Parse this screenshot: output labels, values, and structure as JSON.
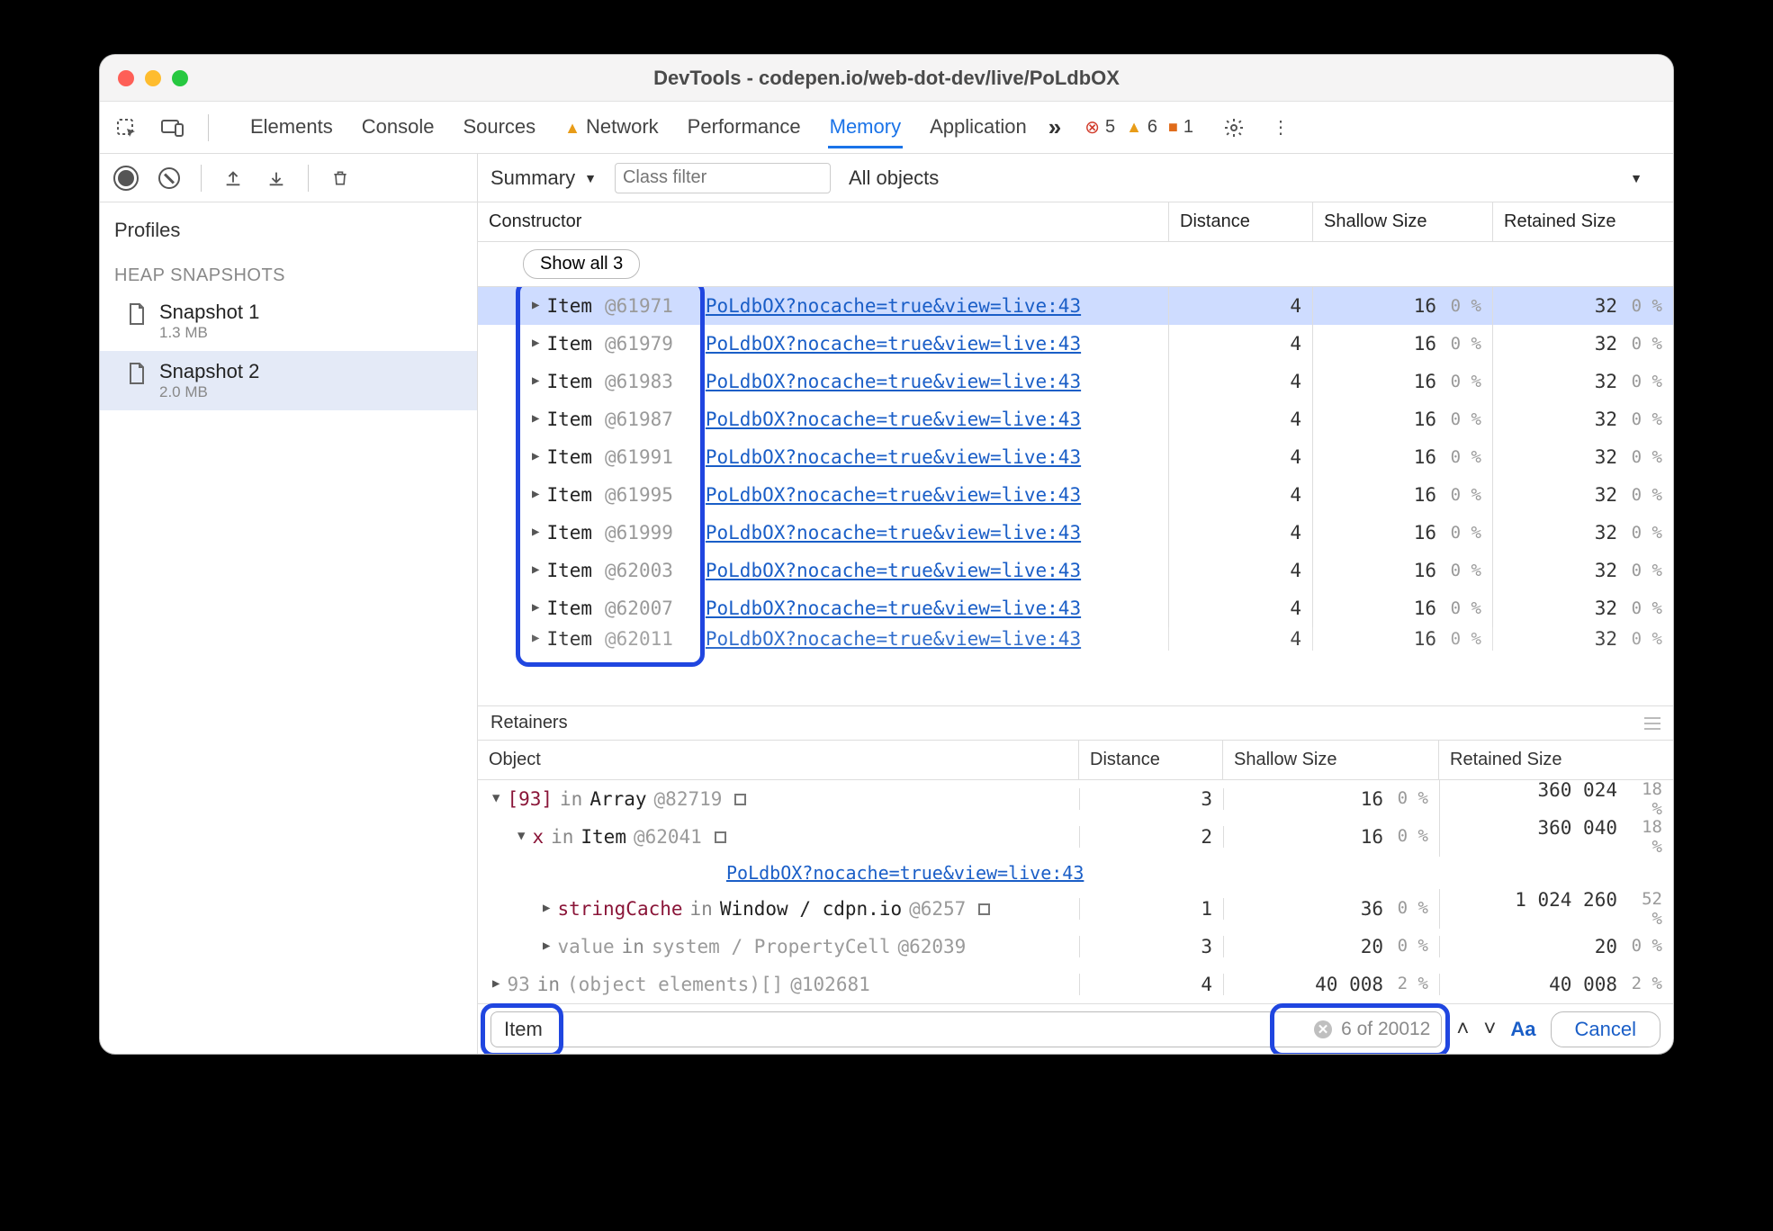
{
  "titlebar": {
    "title": "DevTools - codepen.io/web-dot-dev/live/PoLdbOX"
  },
  "tabs": {
    "items": [
      "Elements",
      "Console",
      "Sources",
      "Network",
      "Performance",
      "Memory",
      "Application"
    ],
    "active": "Memory",
    "warn_tab_index": 3
  },
  "counters": {
    "errors": "5",
    "warnings": "6",
    "issues": "1"
  },
  "filterbar": {
    "view": "Summary",
    "class_filter_placeholder": "Class filter",
    "scope": "All objects"
  },
  "profiles": {
    "title": "Profiles",
    "category": "HEAP SNAPSHOTS",
    "snapshots": [
      {
        "name": "Snapshot 1",
        "size": "1.3 MB",
        "selected": false
      },
      {
        "name": "Snapshot 2",
        "size": "2.0 MB",
        "selected": true
      }
    ]
  },
  "snapshot_headers": {
    "constructor": "Constructor",
    "distance": "Distance",
    "shallow": "Shallow Size",
    "retained": "Retained Size"
  },
  "show_all": "Show all 3",
  "snapshot_rows": [
    {
      "name": "Item",
      "id": "@61971",
      "link": "PoLdbOX?nocache=true&view=live:43",
      "distance": "4",
      "shallow": "16",
      "shallow_pct": "0 %",
      "retained": "32",
      "retained_pct": "0 %",
      "selected": true
    },
    {
      "name": "Item",
      "id": "@61979",
      "link": "PoLdbOX?nocache=true&view=live:43",
      "distance": "4",
      "shallow": "16",
      "shallow_pct": "0 %",
      "retained": "32",
      "retained_pct": "0 %"
    },
    {
      "name": "Item",
      "id": "@61983",
      "link": "PoLdbOX?nocache=true&view=live:43",
      "distance": "4",
      "shallow": "16",
      "shallow_pct": "0 %",
      "retained": "32",
      "retained_pct": "0 %"
    },
    {
      "name": "Item",
      "id": "@61987",
      "link": "PoLdbOX?nocache=true&view=live:43",
      "distance": "4",
      "shallow": "16",
      "shallow_pct": "0 %",
      "retained": "32",
      "retained_pct": "0 %"
    },
    {
      "name": "Item",
      "id": "@61991",
      "link": "PoLdbOX?nocache=true&view=live:43",
      "distance": "4",
      "shallow": "16",
      "shallow_pct": "0 %",
      "retained": "32",
      "retained_pct": "0 %"
    },
    {
      "name": "Item",
      "id": "@61995",
      "link": "PoLdbOX?nocache=true&view=live:43",
      "distance": "4",
      "shallow": "16",
      "shallow_pct": "0 %",
      "retained": "32",
      "retained_pct": "0 %"
    },
    {
      "name": "Item",
      "id": "@61999",
      "link": "PoLdbOX?nocache=true&view=live:43",
      "distance": "4",
      "shallow": "16",
      "shallow_pct": "0 %",
      "retained": "32",
      "retained_pct": "0 %"
    },
    {
      "name": "Item",
      "id": "@62003",
      "link": "PoLdbOX?nocache=true&view=live:43",
      "distance": "4",
      "shallow": "16",
      "shallow_pct": "0 %",
      "retained": "32",
      "retained_pct": "0 %"
    },
    {
      "name": "Item",
      "id": "@62007",
      "link": "PoLdbOX?nocache=true&view=live:43",
      "distance": "4",
      "shallow": "16",
      "shallow_pct": "0 %",
      "retained": "32",
      "retained_pct": "0 %"
    },
    {
      "name": "Item",
      "id": "@62011",
      "link": "PoLdbOX?nocache=true&view=live:43",
      "distance": "4",
      "shallow": "16",
      "shallow_pct": "0 %",
      "retained": "32",
      "retained_pct": "0 %",
      "peek": true
    }
  ],
  "retainers": {
    "label": "Retainers",
    "headers": {
      "object": "Object",
      "distance": "Distance",
      "shallow": "Shallow Size",
      "retained": "Retained Size"
    },
    "rows": [
      {
        "indent": 0,
        "arrow": "▼",
        "prop": "[93]",
        "kw": "in",
        "obj": "Array",
        "id": "@82719",
        "sq": true,
        "distance": "3",
        "shallow": "16",
        "shallow_pct": "0 %",
        "retained": "360 024",
        "retained_pct": "18 %"
      },
      {
        "indent": 1,
        "arrow": "▼",
        "prop": "x",
        "kw": "in",
        "obj": "Item",
        "id": "@62041",
        "sq": true,
        "distance": "2",
        "shallow": "16",
        "shallow_pct": "0 %",
        "retained": "360 040",
        "retained_pct": "18 %"
      },
      {
        "indent": 2,
        "link": "PoLdbOX?nocache=true&view=live:43"
      },
      {
        "indent": 2,
        "arrow": "▶",
        "prop": "stringCache",
        "kw": "in",
        "obj": "Window / cdpn.io",
        "id": "@6257",
        "sq": true,
        "distance": "1",
        "shallow": "36",
        "shallow_pct": "0 %",
        "retained": "1 024 260",
        "retained_pct": "52 %"
      },
      {
        "indent": 2,
        "arrow": "▶",
        "prop": "value",
        "kw": "in",
        "obj": "system / PropertyCell",
        "id": "@62039",
        "muted": true,
        "distance": "3",
        "shallow": "20",
        "shallow_pct": "0 %",
        "retained": "20",
        "retained_pct": "0 %"
      },
      {
        "indent": 0,
        "arrow": "▶",
        "prop": "93",
        "kw": "in",
        "obj": "(object elements)[]",
        "id": "@102681",
        "muted": true,
        "distance": "4",
        "shallow": "40 008",
        "shallow_pct": "2 %",
        "retained": "40 008",
        "retained_pct": "2 %"
      }
    ]
  },
  "search": {
    "value": "Item",
    "counter": "6 of 20012",
    "match_case": "Aa",
    "cancel": "Cancel"
  }
}
